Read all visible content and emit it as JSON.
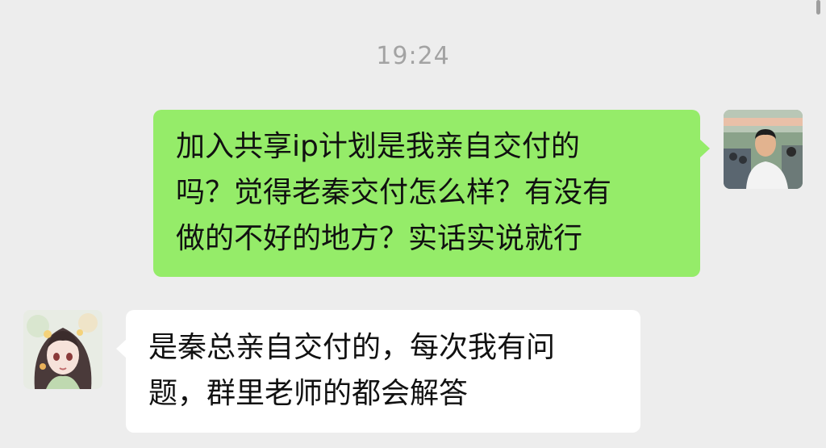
{
  "chat": {
    "timestamp": "19:24",
    "messages": [
      {
        "sender": "self",
        "avatar": "man-photo-avatar",
        "lines": [
          "加入共享ip计划是我亲自交付的",
          "吗？觉得老秦交付怎么样？有没有",
          "做的不好的地方？实话实说就行"
        ]
      },
      {
        "sender": "other",
        "avatar": "anime-girl-avatar",
        "lines": [
          "是秦总亲自交付的，每次我有问",
          "题，群里老师的都会解答"
        ]
      }
    ]
  },
  "colors": {
    "background": "#ededed",
    "sent_bubble": "#95ec69",
    "received_bubble": "#ffffff",
    "timestamp_text": "#a3a3a3"
  }
}
